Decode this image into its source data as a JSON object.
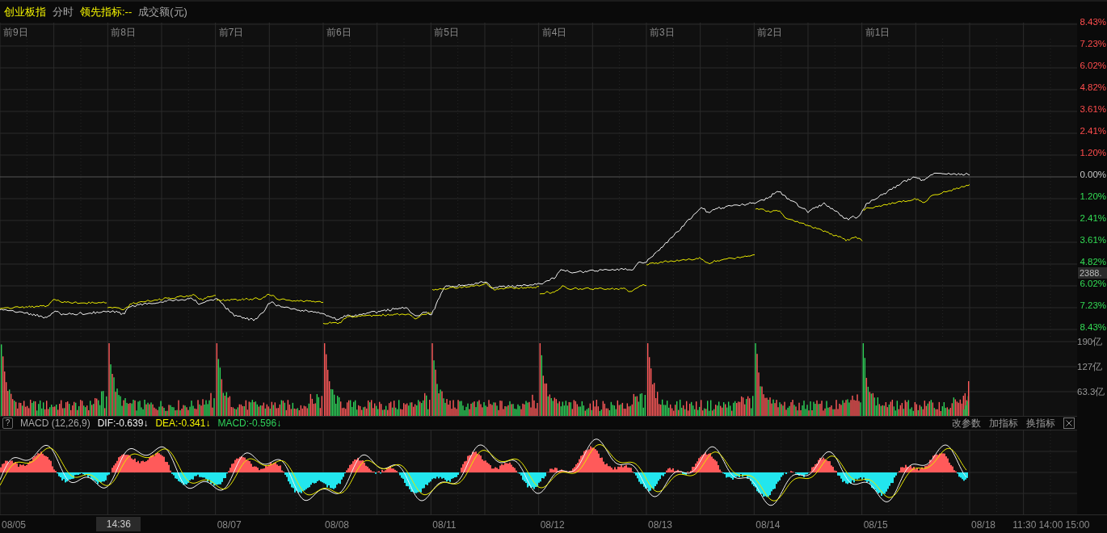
{
  "header": {
    "title": "创业板指",
    "mode": "分时",
    "indicator_label": "领先指标:--",
    "volume_label": "成交额(元)"
  },
  "day_labels": [
    "前9日",
    "前8日",
    "前7日",
    "前6日",
    "前5日",
    "前4日",
    "前3日",
    "前2日",
    "前1日"
  ],
  "percent_ticks": [
    {
      "label": "8.43%",
      "kind": "up"
    },
    {
      "label": "7.23%",
      "kind": "up"
    },
    {
      "label": "6.02%",
      "kind": "up"
    },
    {
      "label": "4.82%",
      "kind": "up"
    },
    {
      "label": "3.61%",
      "kind": "up"
    },
    {
      "label": "2.41%",
      "kind": "up"
    },
    {
      "label": "1.20%",
      "kind": "up"
    },
    {
      "label": "0.00%",
      "kind": "flat"
    },
    {
      "label": "1.20%",
      "kind": "down"
    },
    {
      "label": "2.41%",
      "kind": "down"
    },
    {
      "label": "3.61%",
      "kind": "down"
    },
    {
      "label": "4.82%",
      "kind": "down"
    },
    {
      "label": "6.02%",
      "kind": "down"
    },
    {
      "label": "7.23%",
      "kind": "down"
    },
    {
      "label": "8.43%",
      "kind": "down"
    }
  ],
  "price_tag": "2388.",
  "volume_ticks": [
    "190亿",
    "127亿",
    "63.3亿"
  ],
  "macd": {
    "help": "?",
    "name": "MACD (12,26,9)",
    "dif": "DIF:-0.639↓",
    "dea": "DEA:-0.341↓",
    "macd": "MACD:-0.596↓"
  },
  "macd_buttons": [
    "改参数",
    "加指标",
    "换指标"
  ],
  "date_axis": [
    {
      "label": "08/05",
      "kind": "date"
    },
    {
      "label": "14:36",
      "kind": "cursor"
    },
    {
      "label": "08/07",
      "kind": "date"
    },
    {
      "label": "08/08",
      "kind": "date"
    },
    {
      "label": "08/11",
      "kind": "date"
    },
    {
      "label": "08/12",
      "kind": "date"
    },
    {
      "label": "08/13",
      "kind": "date"
    },
    {
      "label": "08/14",
      "kind": "date"
    },
    {
      "label": "08/15",
      "kind": "date"
    },
    {
      "label": "08/18",
      "kind": "date"
    }
  ],
  "time_ticks": [
    "11:30",
    "14:00",
    "15:00"
  ]
}
